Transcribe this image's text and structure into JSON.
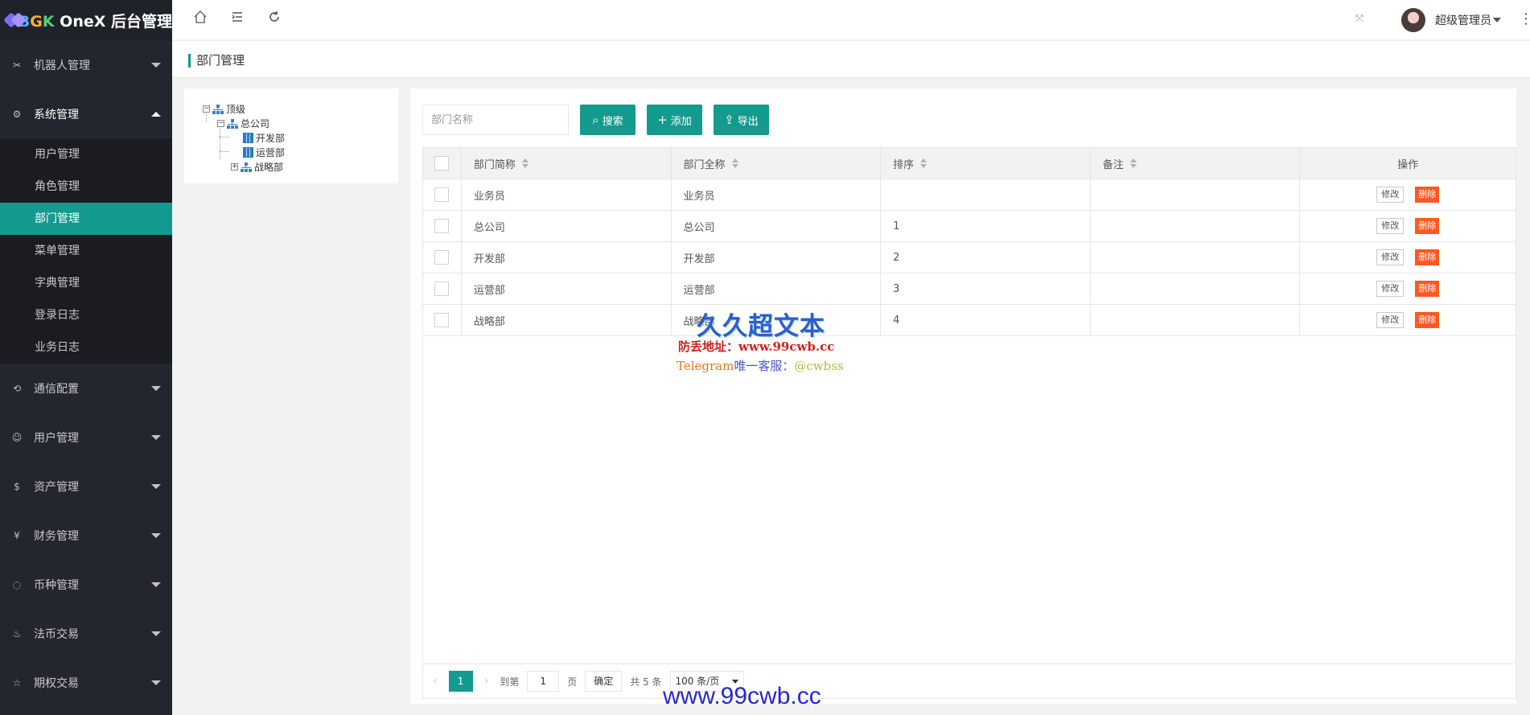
{
  "app": {
    "logo_b": "B",
    "logo_g": "G",
    "logo_k": "K",
    "logo_rest": " OneX 后台管理"
  },
  "sidebar": {
    "groups": [
      {
        "label": "机器人管理",
        "icon": "robot-icon"
      },
      {
        "label": "系统管理",
        "icon": "gear-icon"
      },
      {
        "label": "通信配置",
        "icon": "signal-icon"
      },
      {
        "label": "用户管理",
        "icon": "user-icon"
      },
      {
        "label": "资产管理",
        "icon": "dollar-icon"
      },
      {
        "label": "财务管理",
        "icon": "yen-icon"
      },
      {
        "label": "币种管理",
        "icon": "coin-icon"
      },
      {
        "label": "法币交易",
        "icon": "fire-icon"
      },
      {
        "label": "期权交易",
        "icon": "star-icon"
      }
    ],
    "sub_items": [
      "用户管理",
      "角色管理",
      "部门管理",
      "菜单管理",
      "字典管理",
      "登录日志",
      "业务日志"
    ],
    "active_sub": "部门管理"
  },
  "header": {
    "user_name": "超级管理员",
    "icons": [
      "home-icon",
      "menu-fold-icon",
      "refresh-icon",
      "fullscreen-icon",
      "more-icon"
    ]
  },
  "tab": {
    "title": "部门管理"
  },
  "tree": {
    "root": "顶级",
    "company": "总公司",
    "dept1": "开发部",
    "dept2": "运营部",
    "dept3": "战略部"
  },
  "toolbar": {
    "search_placeholder": "部门名称",
    "search_label": "搜索",
    "add_label": "添加",
    "export_label": "导出"
  },
  "table": {
    "columns": [
      "部门简称",
      "部门全称",
      "排序",
      "备注",
      "操作"
    ],
    "rows": [
      {
        "short": "业务员",
        "full": "业务员",
        "sort": "",
        "note": ""
      },
      {
        "short": "总公司",
        "full": "总公司",
        "sort": "1",
        "note": ""
      },
      {
        "short": "开发部",
        "full": "开发部",
        "sort": "2",
        "note": ""
      },
      {
        "short": "运营部",
        "full": "运营部",
        "sort": "3",
        "note": ""
      },
      {
        "short": "战略部",
        "full": "战略部",
        "sort": "4",
        "note": ""
      }
    ],
    "edit_label": "修改",
    "delete_label": "删除"
  },
  "pager": {
    "current": "1",
    "goto_label": "到第",
    "goto_value": "1",
    "page_label": "页",
    "confirm_label": "确定",
    "total_label": "共 5 条",
    "page_size": "100 条/页"
  },
  "watermark": {
    "line1": "久久超文本",
    "line2": "防丢地址：www.99cwb.cc",
    "line3a": "Telegram",
    "line3b": "唯一客服：",
    "line3c": "@cwbss",
    "line4": "www.99cwb.cc"
  },
  "colors": {
    "accent": "#149a8e",
    "danger": "#ff5722",
    "sidebar_bg": "#23262e"
  }
}
